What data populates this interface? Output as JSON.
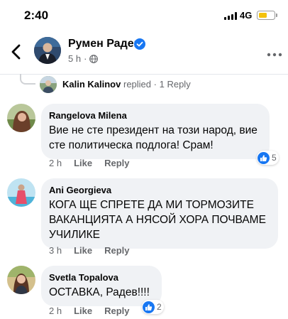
{
  "status_bar": {
    "time": "2:40",
    "network": "4G",
    "battery_level": 0.55,
    "battery_color": "#f4c20d"
  },
  "header": {
    "name": "Румен Радев",
    "post_time": "5 h",
    "audience_icon": "globe-icon",
    "verified_color": "#1877f2"
  },
  "reply_thread": {
    "author": "Kalin Kalinov",
    "action": "replied",
    "separator": "·",
    "count_label": "1 Reply"
  },
  "comments": [
    {
      "author": "Rangelova Milena",
      "text": "Вие не сте президент на този народ, вие сте политическа подлога! Срам!",
      "time": "2 h",
      "like_label": "Like",
      "reply_label": "Reply",
      "reaction_count": "5"
    },
    {
      "author": "Ani Georgieva",
      "text": "КОГА ЩЕ СПРЕТЕ ДА МИ ТОРМОЗИТЕ ВАКАНЦИЯТА А НЯСОЙ ХОРА ПОЧВАМЕ УЧИЛИКЕ",
      "time": "3 h",
      "like_label": "Like",
      "reply_label": "Reply",
      "reaction_count": ""
    },
    {
      "author": "Svetla Topalova",
      "text": "ОСТАВКА, Радев!!!!",
      "time": "2 h",
      "like_label": "Like",
      "reply_label": "Reply",
      "reaction_count": "2"
    }
  ],
  "colors": {
    "bubble": "#f0f2f5",
    "meta_text": "#65676b",
    "brand_blue": "#1877f2"
  }
}
